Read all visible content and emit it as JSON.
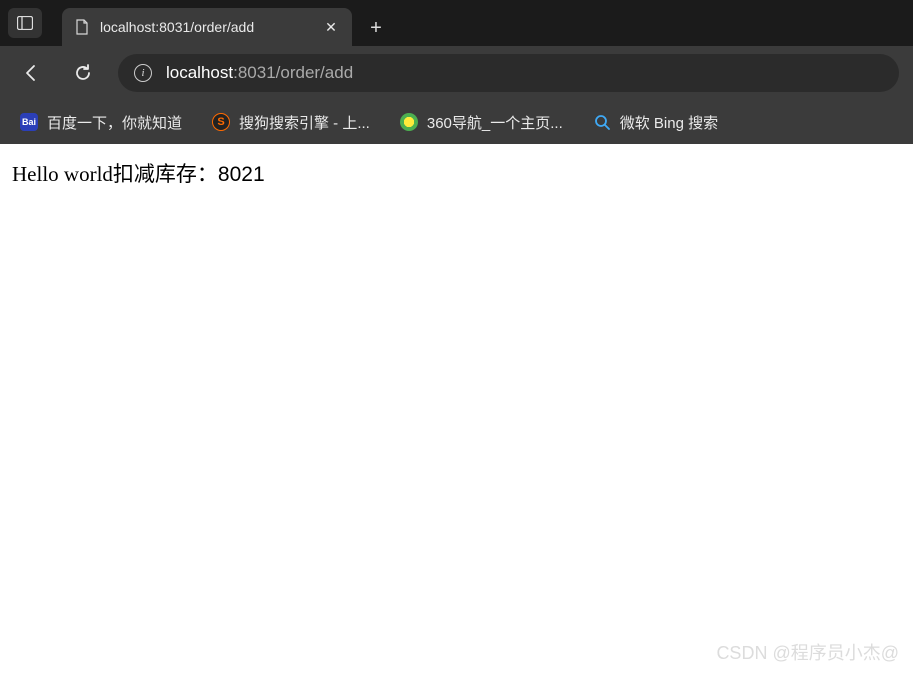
{
  "tab": {
    "title": "localhost:8031/order/add",
    "close_glyph": "✕",
    "new_tab_glyph": "+"
  },
  "address": {
    "info_glyph": "i",
    "host": "localhost",
    "path": ":8031/order/add"
  },
  "bookmarks": [
    {
      "icon_text": "Bai",
      "label": "百度一下，你就知道"
    },
    {
      "icon_text": "S",
      "label": "搜狗搜索引擎 - 上..."
    },
    {
      "icon_text": "",
      "label": "360导航_一个主页..."
    },
    {
      "icon_text": "🔍",
      "label": "微软 Bing 搜索"
    }
  ],
  "page": {
    "text_en": "Hello world",
    "text_cn": "扣减库存：8021"
  },
  "watermark": "CSDN @程序员小杰@"
}
